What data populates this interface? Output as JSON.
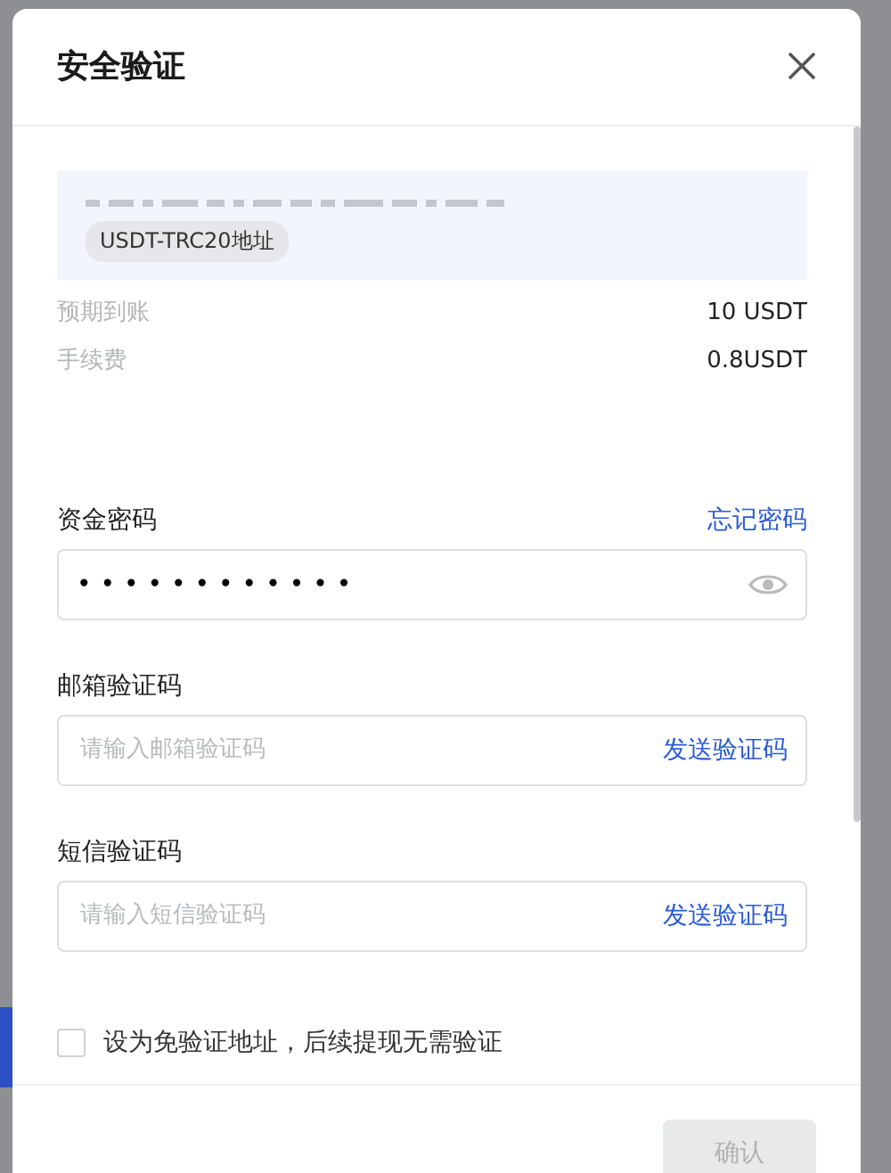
{
  "dialog": {
    "title": "安全验证",
    "address": {
      "tag": "USDT-TRC20地址"
    },
    "summary": [
      {
        "label": "预期到账",
        "value": "10 USDT"
      },
      {
        "label": "手续费",
        "value": "0.8USDT"
      }
    ],
    "fields": [
      {
        "kind": "password",
        "label": "资金密码",
        "link": "忘记密码",
        "value": "••••••••••••"
      },
      {
        "kind": "code",
        "label": "邮箱验证码",
        "placeholder": "请输入邮箱验证码",
        "action": "发送验证码"
      },
      {
        "kind": "code",
        "label": "短信验证码",
        "placeholder": "请输入短信验证码",
        "action": "发送验证码"
      }
    ],
    "whitelist": {
      "label": "设为免验证地址，后续提现无需验证",
      "checked": false
    },
    "confirm": {
      "label": "确认",
      "disabled": true
    }
  }
}
